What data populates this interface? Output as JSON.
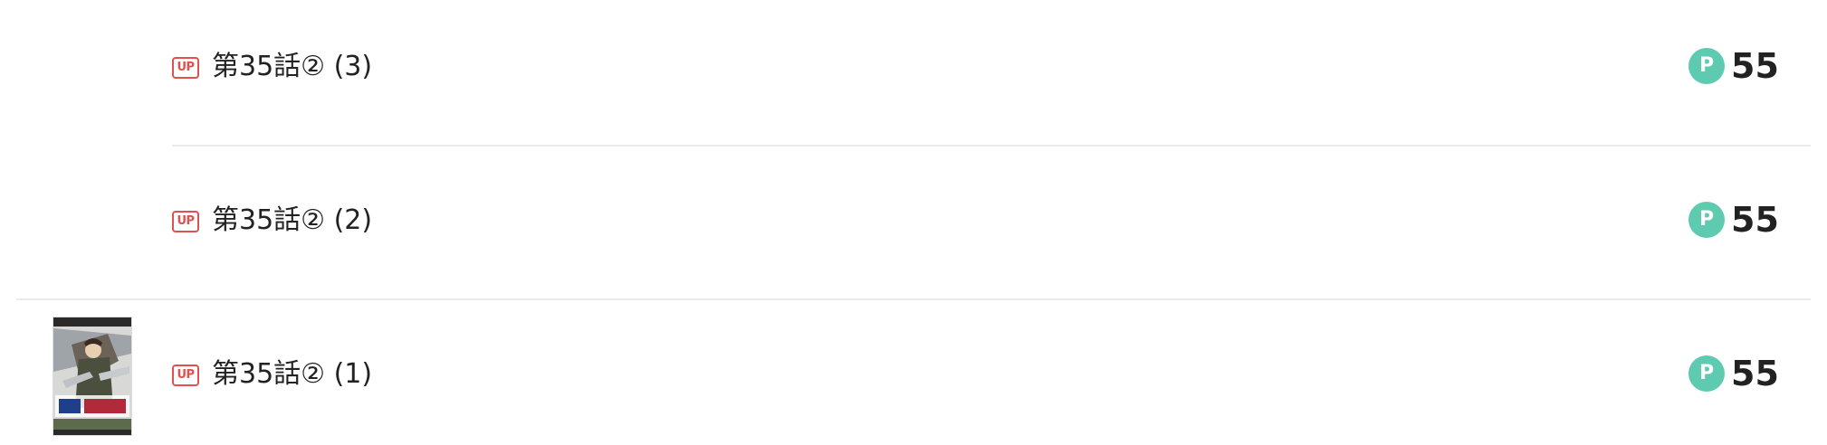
{
  "episodes": [
    {
      "badge": "UP",
      "title": "第35話② (3)",
      "point_symbol": "P",
      "price": "55",
      "has_thumbnail": false
    },
    {
      "badge": "UP",
      "title": "第35話② (2)",
      "point_symbol": "P",
      "price": "55",
      "has_thumbnail": false
    },
    {
      "badge": "UP",
      "title": "第35話② (1)",
      "point_symbol": "P",
      "price": "55",
      "has_thumbnail": true
    }
  ],
  "colors": {
    "up_badge": "#e0524f",
    "point_icon": "#5ecbb0",
    "divider": "#ebebeb",
    "text": "#222222"
  },
  "icons": {
    "badge": "up-badge-icon",
    "point": "point-coin-icon",
    "thumbnail": "comic-cover-thumbnail"
  }
}
